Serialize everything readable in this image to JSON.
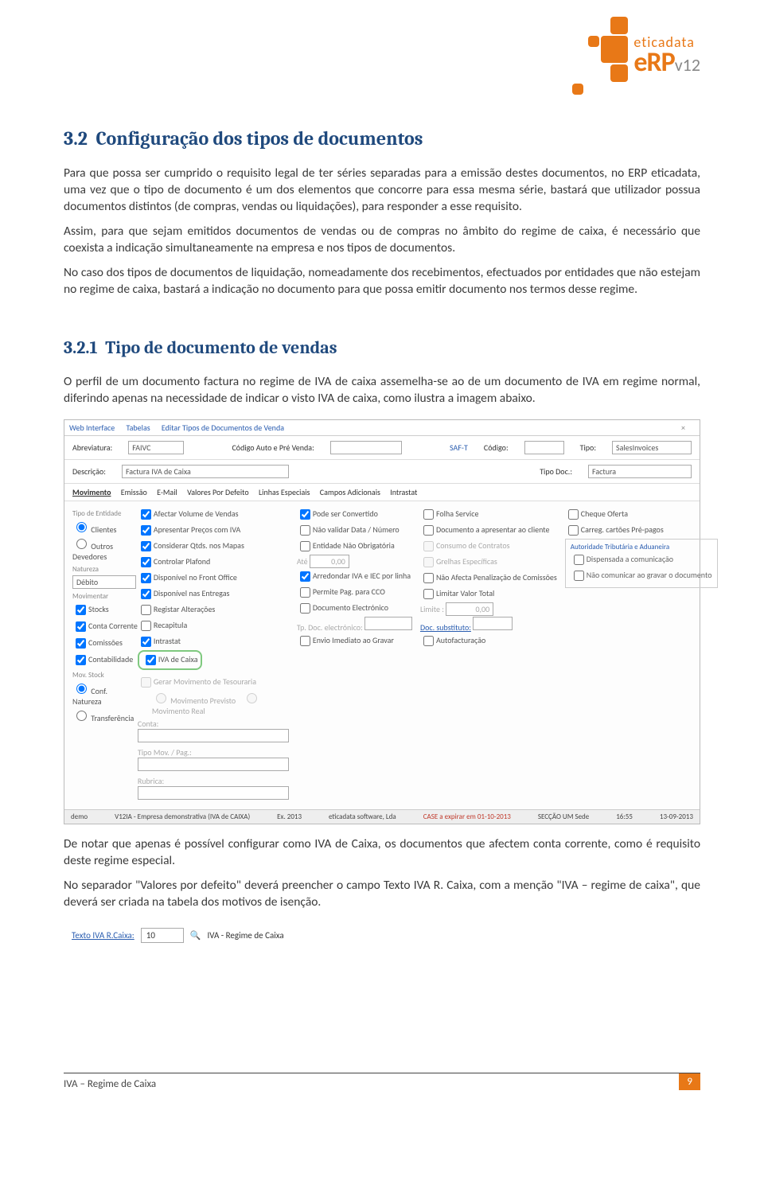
{
  "logo": {
    "brand": "eticadata",
    "product": "eRP",
    "version": "v12"
  },
  "section": {
    "num": "3.2",
    "title": "Configuração dos tipos de documentos",
    "p1": "Para que possa ser cumprido o requisito legal de ter séries separadas para a emissão destes documentos, no ERP eticadata, uma vez que o tipo de documento é um dos elementos que concorre para essa mesma série, bastará que utilizador possua documentos distintos (de compras, vendas ou liquidações), para responder a esse requisito.",
    "p2": "Assim, para que sejam emitidos documentos de vendas ou de compras no âmbito do regime de caixa, é necessário que coexista a indicação simultaneamente na empresa e nos tipos de documentos.",
    "p3": "No caso dos tipos de documentos de liquidação, nomeadamente dos recebimentos, efectuados por entidades que não estejam no regime de caixa, bastará a indicação no documento para que possa emitir documento nos termos desse regime."
  },
  "subsection": {
    "num": "3.2.1",
    "title": "Tipo de documento de vendas",
    "p1": "O perfil de um documento factura no regime de IVA de caixa assemelha-se ao de um documento de IVA em regime normal, diferindo apenas na necessidade de indicar o visto IVA de caixa, como ilustra a imagem abaixo.",
    "p2": "De notar que apenas é possível configurar como IVA de Caixa, os documentos que afectem conta corrente, como é requisito deste regime especial.",
    "p3": "No separador \"Valores por defeito\" deverá preencher o campo Texto IVA R. Caixa, com a menção \"IVA – regime de caixa\", que deverá ser criada na tabela dos motivos de isenção."
  },
  "shot1": {
    "tabs": [
      "Web Interface",
      "Tabelas",
      "Editar Tipos de Documentos de Venda"
    ],
    "header": {
      "abrev_lbl": "Abreviatura:",
      "abrev_val": "FAIVC",
      "codauto_lbl": "Código Auto e Pré Venda:",
      "saft_lbl": "SAF-T",
      "codigo_lbl": "Código:",
      "tipo_lbl": "Tipo:",
      "tipo_val": "SalesInvoices",
      "desc_lbl": "Descrição:",
      "desc_val": "Factura IVA de Caixa",
      "tipodoc_lbl": "Tipo Doc.:",
      "tipodoc_val": "Factura"
    },
    "subtabs": [
      "Movimento",
      "Emissão",
      "E-Mail",
      "Valores Por Defeito",
      "Linhas Especiais",
      "Campos Adicionais",
      "Intrastat"
    ],
    "left": {
      "grp1": "Tipo de Entidade",
      "r1": "Clientes",
      "r2": "Outros Devedores",
      "grp2": "Natureza",
      "sel": "Débito",
      "grp3": "Movimentar",
      "c1": "Stocks",
      "c2": "Conta Corrente",
      "c3": "Comissões",
      "c4": "Contabilidade",
      "grp4": "Mov. Stock",
      "r3": "Conf. Natureza",
      "r4": "Transferência"
    },
    "col1": {
      "c1": "Afectar Volume de Vendas",
      "c2": "Apresentar Preços com IVA",
      "c3": "Considerar Qtds. nos Mapas",
      "c4": "Controlar Plafond",
      "c5": "Disponível no Front Office",
      "c6": "Disponível nas Entregas",
      "c7": "Registar Alterações",
      "c8": "Recapitula",
      "c9": "Intrastat",
      "c10": "IVA de Caixa",
      "c11": "Gerar Movimento de Tesouraria",
      "r1": "Movimento Previsto",
      "r2": "Movimento Real",
      "conta": "Conta:",
      "tipomov": "Tipo Mov. / Pag.:",
      "rubrica": "Rubrica:"
    },
    "col2": {
      "c1": "Pode ser Convertido",
      "c2": "Não validar Data / Número",
      "c3": "Entidade Não Obrigatória",
      "ate": "Até",
      "ateval": "0,00",
      "c4": "Arredondar IVA e IEC por linha",
      "c5": "Permite Pag. para CCO",
      "c6": "Documento Electrónico",
      "tpdoc": "Tp. Doc. electrónico:",
      "c7": "Envio Imediato ao Gravar"
    },
    "col3": {
      "c1": "Folha Service",
      "c2": "Documento a apresentar ao cliente",
      "c3": "Consumo de Contratos",
      "c4": "Grelhas Específicas",
      "c5": "Não Afecta Penalização de Comissões",
      "c6": "Limitar Valor Total",
      "limite": "Limite :",
      "limiteval": "0,00",
      "docsub": "Doc. substituto:",
      "c7": "Autofacturação"
    },
    "col4": {
      "c1": "Cheque Oferta",
      "c2": "Carreg. cartões Pré-pagos",
      "box": "Autoridade Tributária e Aduaneira",
      "c3": "Dispensada a comunicação",
      "c4": "Não comunicar ao gravar o documento"
    },
    "status": {
      "user": "demo",
      "empresa": "V12IA - Empresa demonstrativa (IVA de CAIXA)",
      "ex": "Ex. 2013",
      "co": "eticadata software, Lda",
      "warn": "CASE a expirar em 01-10-2013",
      "seccao": "SECÇÃO UM Sede",
      "time": "16:55",
      "date": "13-09-2013"
    }
  },
  "shot2": {
    "lbl": "Texto IVA R.Caixa:",
    "code": "10",
    "desc": "IVA - Regime de Caixa"
  },
  "footer": {
    "text": "IVA – Regime de Caixa"
  },
  "pagenum": "9"
}
